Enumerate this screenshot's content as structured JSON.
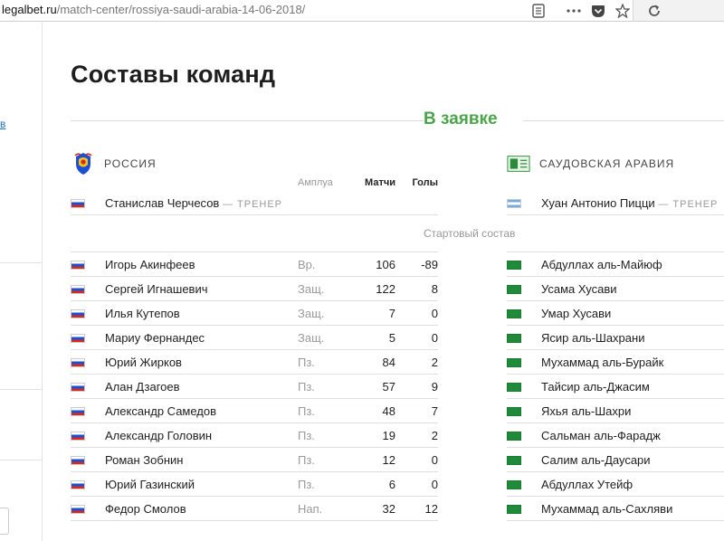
{
  "browser": {
    "url_host": "legalbet.ru",
    "url_path": "/match-center/rossiya-saudi-arabia-14-06-2018/"
  },
  "sidebar": {
    "link_text": "в"
  },
  "page": {
    "title": "Составы команд",
    "section_title": "В заявке",
    "starting_label": "Стартовый состав"
  },
  "columns": {
    "role": "Амплуа",
    "matches": "Матчи",
    "goals": "Голы"
  },
  "team_left": {
    "name": "РОССИЯ",
    "coach_name": "Станислав Черчесов",
    "coach_tag": "— ТРЕНЕР",
    "players": [
      {
        "name": "Игорь Акинфеев",
        "role": "Вр.",
        "matches": "106",
        "goals": "-89"
      },
      {
        "name": "Сергей Игнашевич",
        "role": "Защ.",
        "matches": "122",
        "goals": "8"
      },
      {
        "name": "Илья Кутепов",
        "role": "Защ.",
        "matches": "7",
        "goals": "0"
      },
      {
        "name": "Мариу Фернандес",
        "role": "Защ.",
        "matches": "5",
        "goals": "0"
      },
      {
        "name": "Юрий Жирков",
        "role": "Пз.",
        "matches": "84",
        "goals": "2"
      },
      {
        "name": "Алан Дзагоев",
        "role": "Пз.",
        "matches": "57",
        "goals": "9"
      },
      {
        "name": "Александр Самедов",
        "role": "Пз.",
        "matches": "48",
        "goals": "7"
      },
      {
        "name": "Александр Головин",
        "role": "Пз.",
        "matches": "19",
        "goals": "2"
      },
      {
        "name": "Роман Зобнин",
        "role": "Пз.",
        "matches": "12",
        "goals": "0"
      },
      {
        "name": "Юрий Газинский",
        "role": "Пз.",
        "matches": "6",
        "goals": "0"
      },
      {
        "name": "Федор Смолов",
        "role": "Нап.",
        "matches": "32",
        "goals": "12"
      }
    ]
  },
  "team_right": {
    "name": "САУДОВСКАЯ АРАВИЯ",
    "coach_name": "Хуан Антонио Пицци",
    "coach_tag": "— ТРЕНЕР",
    "players": [
      {
        "name": "Абдуллах аль-Майюф"
      },
      {
        "name": "Усама Хусави"
      },
      {
        "name": "Умар Хусави"
      },
      {
        "name": "Ясир аль-Шахрани"
      },
      {
        "name": "Мухаммад аль-Бурайк"
      },
      {
        "name": "Тайсир аль-Джасим"
      },
      {
        "name": "Яхья аль-Шахри"
      },
      {
        "name": "Сальман аль-Фарадж"
      },
      {
        "name": "Салим аль-Даусари"
      },
      {
        "name": "Абдуллах Утейф"
      },
      {
        "name": "Мухаммад аль-Сахляви"
      }
    ]
  },
  "colors": {
    "accent_green": "#4aa44a",
    "muted_text": "#999999",
    "link_blue": "#1a73c8"
  },
  "icons": [
    "reader-mode-icon",
    "more-icon",
    "pocket-icon",
    "bookmark-star-icon",
    "reload-icon",
    "russia-emblem-icon",
    "saudi-emblem-icon"
  ]
}
